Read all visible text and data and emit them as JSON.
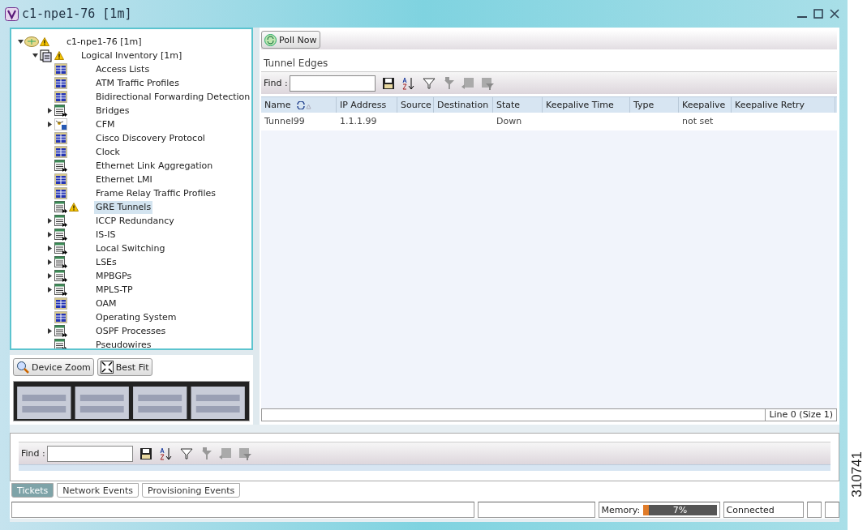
{
  "window": {
    "title": "c1-npe1-76 [1m]"
  },
  "tree": [
    {
      "label": "c1-npe1-76 [1m]",
      "kind": "device",
      "warning": true,
      "expanded": true,
      "selected": false,
      "children": [
        {
          "label": "Logical Inventory [1m]",
          "kind": "inventory",
          "warning": true,
          "expanded": true,
          "selected": false,
          "children": [
            {
              "label": "Access Lists",
              "kind": "table",
              "warning": false,
              "expanded": false,
              "expandable": false,
              "selected": false
            },
            {
              "label": "ATM Traffic Profiles",
              "kind": "table",
              "warning": false,
              "expanded": false,
              "expandable": false,
              "selected": false
            },
            {
              "label": "Bidirectional Forwarding Detection",
              "kind": "table",
              "warning": false,
              "expanded": false,
              "expandable": false,
              "selected": false
            },
            {
              "label": "Bridges",
              "kind": "list",
              "warning": false,
              "expanded": false,
              "expandable": true,
              "selected": false
            },
            {
              "label": "CFM",
              "kind": "cfm",
              "warning": false,
              "expanded": false,
              "expandable": true,
              "selected": false
            },
            {
              "label": "Cisco Discovery Protocol",
              "kind": "table",
              "warning": false,
              "expanded": false,
              "expandable": false,
              "selected": false
            },
            {
              "label": "Clock",
              "kind": "table",
              "warning": false,
              "expanded": false,
              "expandable": false,
              "selected": false
            },
            {
              "label": "Ethernet Link Aggregation",
              "kind": "list",
              "warning": false,
              "expanded": false,
              "expandable": false,
              "selected": false
            },
            {
              "label": "Ethernet LMI",
              "kind": "table",
              "warning": false,
              "expanded": false,
              "expandable": false,
              "selected": false
            },
            {
              "label": "Frame Relay Traffic Profiles",
              "kind": "table",
              "warning": false,
              "expanded": false,
              "expandable": false,
              "selected": false
            },
            {
              "label": "GRE Tunnels",
              "kind": "list",
              "warning": true,
              "expanded": false,
              "expandable": false,
              "selected": true
            },
            {
              "label": "ICCP Redundancy",
              "kind": "list",
              "warning": false,
              "expanded": false,
              "expandable": true,
              "selected": false
            },
            {
              "label": "IS-IS",
              "kind": "list",
              "warning": false,
              "expanded": false,
              "expandable": true,
              "selected": false
            },
            {
              "label": "Local Switching",
              "kind": "list",
              "warning": false,
              "expanded": false,
              "expandable": true,
              "selected": false
            },
            {
              "label": "LSEs",
              "kind": "list",
              "warning": false,
              "expanded": false,
              "expandable": true,
              "selected": false
            },
            {
              "label": "MPBGPs",
              "kind": "list",
              "warning": false,
              "expanded": false,
              "expandable": true,
              "selected": false
            },
            {
              "label": "MPLS-TP",
              "kind": "list",
              "warning": false,
              "expanded": false,
              "expandable": true,
              "selected": false
            },
            {
              "label": "OAM",
              "kind": "table",
              "warning": false,
              "expanded": false,
              "expandable": false,
              "selected": false
            },
            {
              "label": "Operating System",
              "kind": "table",
              "warning": false,
              "expanded": false,
              "expandable": false,
              "selected": false
            },
            {
              "label": "OSPF Processes",
              "kind": "list",
              "warning": false,
              "expanded": false,
              "expandable": true,
              "selected": false
            },
            {
              "label": "Pseudowires",
              "kind": "list",
              "warning": false,
              "expanded": false,
              "expandable": false,
              "selected": false
            }
          ]
        }
      ]
    }
  ],
  "device_view": {
    "buttons": [
      {
        "label": "Device Zoom",
        "kind": "zoom"
      },
      {
        "label": "Best Fit",
        "kind": "fit"
      }
    ]
  },
  "content": {
    "poll_button": "Poll Now",
    "section_title": "Tunnel Edges",
    "find_label": "Find :",
    "table": {
      "columns": [
        "Name",
        "IP Address",
        "Source",
        "Destination",
        "State",
        "Keepalive Time",
        "Type",
        "Keepalive",
        "Keepalive Retry"
      ],
      "rows": [
        [
          "Tunnel99",
          "1.1.1.99",
          "",
          "",
          "Down",
          "",
          "",
          "not set",
          ""
        ]
      ]
    },
    "footer": "Line 0 (Size 1)"
  },
  "events": {
    "find_label": "Find :",
    "tabs": [
      {
        "label": "Tickets",
        "selected": true
      },
      {
        "label": "Network Events",
        "selected": false
      },
      {
        "label": "Provisioning Events",
        "selected": false
      }
    ]
  },
  "status_bar": {
    "memory_label": "Memory:",
    "memory": {
      "level": 0.07,
      "reading": "7%"
    },
    "connection": "Connected"
  },
  "figure_id": "310741"
}
